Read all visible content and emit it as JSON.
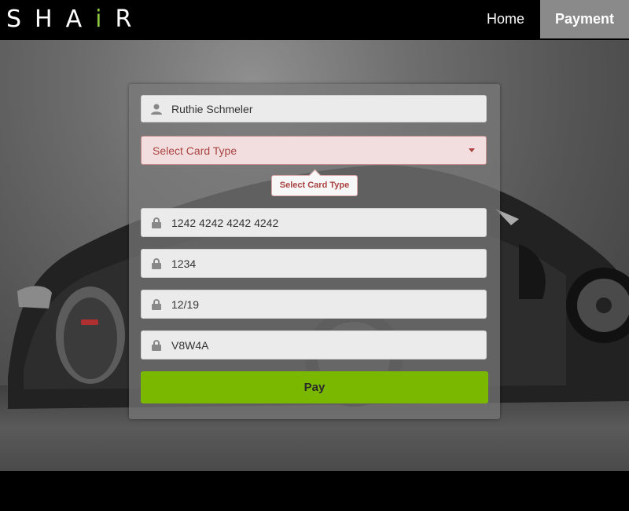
{
  "navbar": {
    "logo_left": "SHA",
    "logo_accent": "i",
    "logo_right": "R",
    "home_label": "Home",
    "payment_label": "Payment"
  },
  "form": {
    "name_value": "Ruthie Schmeler",
    "card_type_placeholder": "Select Card Type",
    "card_type_tooltip": "Select Card Type",
    "card_number_value": "1242 4242 4242 4242",
    "cvv_value": "1234",
    "expiry_value": "12/19",
    "postal_value": "V8W4A",
    "pay_label": "Pay"
  },
  "colors": {
    "accent": "#7ab800",
    "logo_accent": "#8cc63f",
    "active_nav": "#8a8a8a",
    "error_text": "#a94442"
  },
  "icons": {
    "name": "user-icon",
    "card_number": "lock-icon",
    "cvv": "lock-icon",
    "expiry": "lock-icon",
    "postal": "lock-icon",
    "select": "caret-down-icon"
  }
}
